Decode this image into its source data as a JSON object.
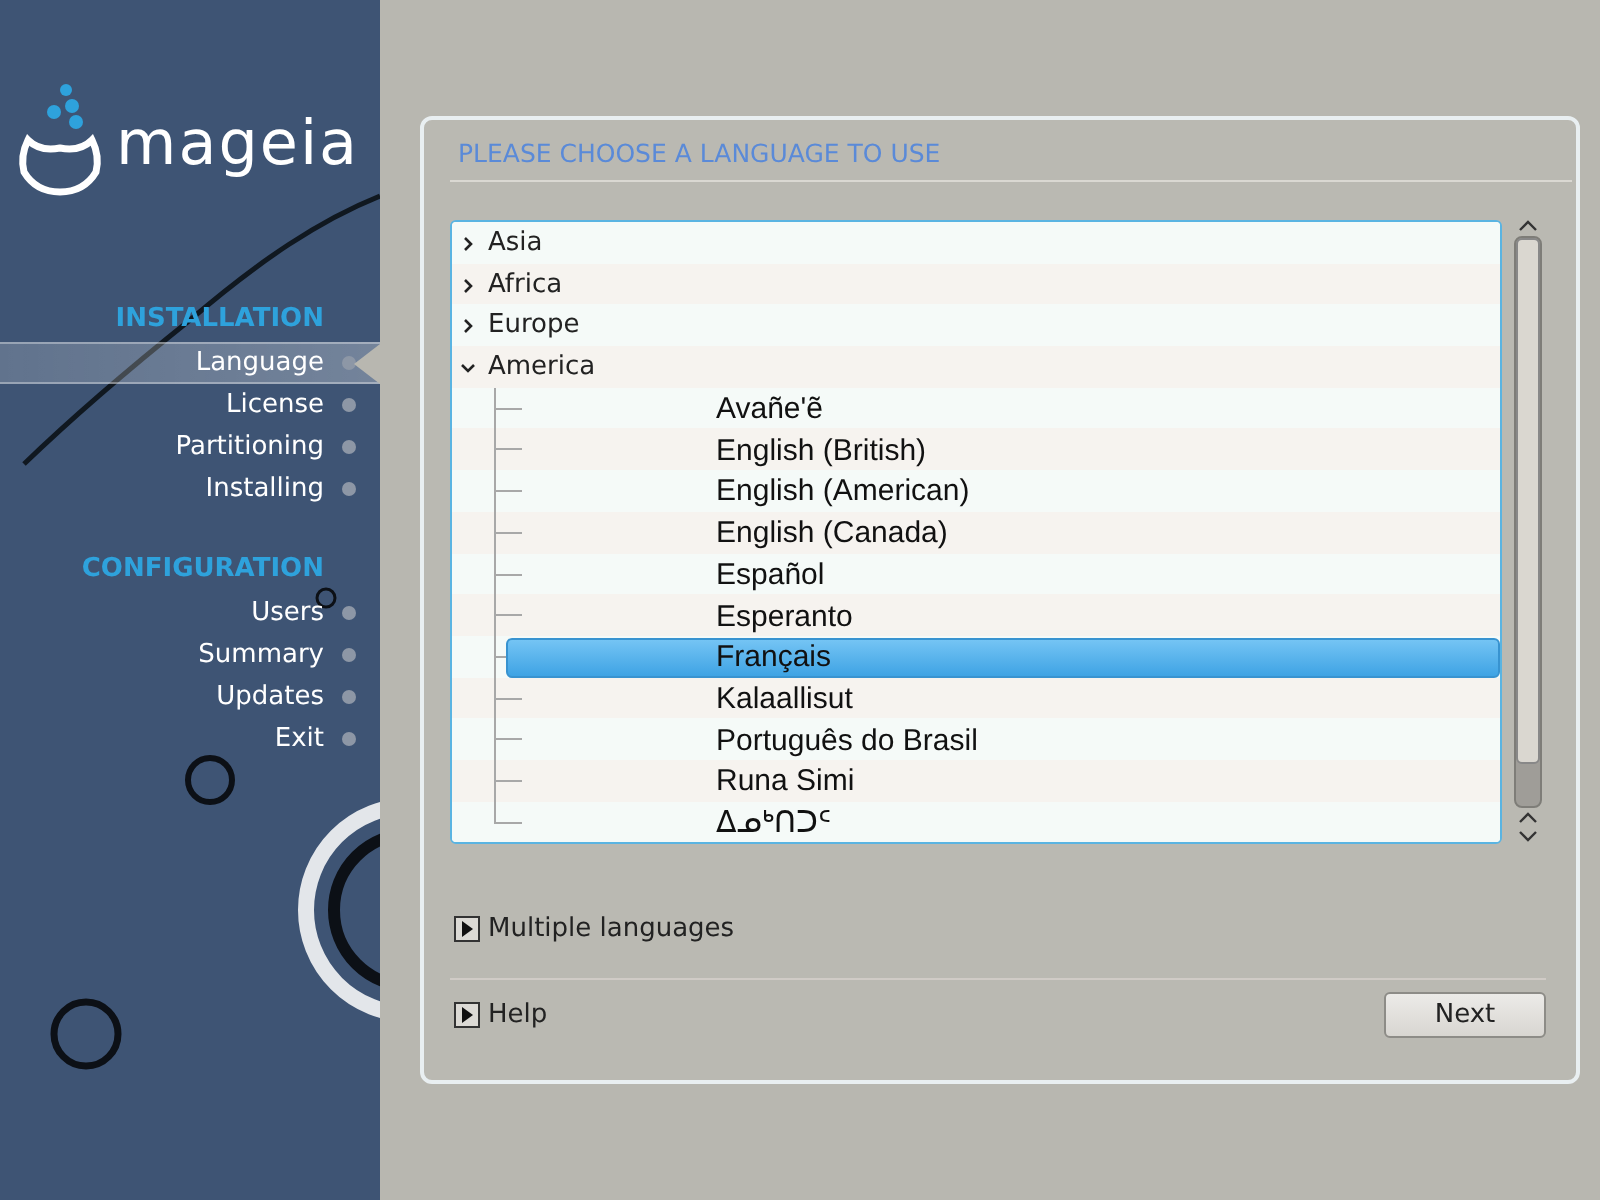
{
  "logo": {
    "text": "mageia"
  },
  "sidebar": {
    "sections": [
      {
        "title": "INSTALLATION",
        "steps": [
          {
            "label": "Language",
            "selected": true
          },
          {
            "label": "License",
            "selected": false
          },
          {
            "label": "Partitioning",
            "selected": false
          },
          {
            "label": "Installing",
            "selected": false
          }
        ]
      },
      {
        "title": "CONFIGURATION",
        "steps": [
          {
            "label": "Users",
            "selected": false
          },
          {
            "label": "Summary",
            "selected": false
          },
          {
            "label": "Updates",
            "selected": false
          },
          {
            "label": "Exit",
            "selected": false
          }
        ]
      }
    ]
  },
  "panel": {
    "title": "PLEASE CHOOSE A LANGUAGE TO USE",
    "tree": [
      {
        "label": "Asia",
        "expanded": false
      },
      {
        "label": "Africa",
        "expanded": false
      },
      {
        "label": "Europe",
        "expanded": false
      },
      {
        "label": "America",
        "expanded": true,
        "children": [
          {
            "label": "Avañe'ẽ",
            "selected": false
          },
          {
            "label": "English (British)",
            "selected": false
          },
          {
            "label": "English (American)",
            "selected": false
          },
          {
            "label": "English (Canada)",
            "selected": false
          },
          {
            "label": "Español",
            "selected": false
          },
          {
            "label": "Esperanto",
            "selected": false
          },
          {
            "label": "Français",
            "selected": true
          },
          {
            "label": "Kalaallisut",
            "selected": false
          },
          {
            "label": "Português do Brasil",
            "selected": false
          },
          {
            "label": "Runa Simi",
            "selected": false
          },
          {
            "label": "ᐃᓄᒃᑎᑐᑦ",
            "selected": false
          }
        ]
      }
    ],
    "multiple_languages": {
      "label": "Multiple languages"
    },
    "help": {
      "label": "Help"
    },
    "buttons": [
      "Next"
    ]
  }
}
